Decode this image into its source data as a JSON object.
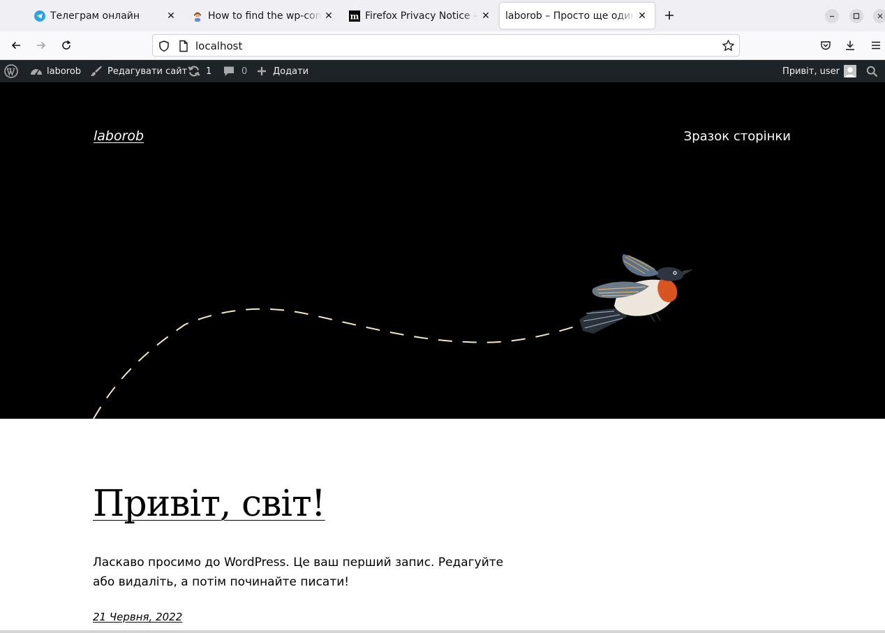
{
  "browser": {
    "tabs": [
      {
        "title": "Телеграм онлайн",
        "favicon": "telegram-icon",
        "active": false
      },
      {
        "title": "How to find the wp-confi",
        "favicon": "user-avatar-icon",
        "active": false
      },
      {
        "title": "Firefox Privacy Notice —",
        "favicon": "mozilla-m-icon",
        "active": false
      },
      {
        "title": "laborob – Просто ще один с",
        "favicon": "none",
        "active": true
      }
    ],
    "url": "localhost"
  },
  "adminbar": {
    "site_name": "laborob",
    "edit_site": "Редагувати сайт",
    "updates_count": "1",
    "comments_count": "0",
    "add_new": "Додати",
    "greeting": "Привіт, user"
  },
  "site": {
    "title": "laborob",
    "nav_link": "Зразок сторінки"
  },
  "post": {
    "title": "Привіт, світ!",
    "body": "Ласкаво просимо до WordPress. Це ваш перший запис. Редагуйте або видаліть, а потім починайте писати!",
    "date": "21 Червня, 2022"
  },
  "colors": {
    "hero_bg": "#000000",
    "adminbar_bg": "#1d2327",
    "tab_bar_bg": "#f0f0f4",
    "dash_line": "#f5e6c8",
    "telegram": "#2aa3df"
  }
}
